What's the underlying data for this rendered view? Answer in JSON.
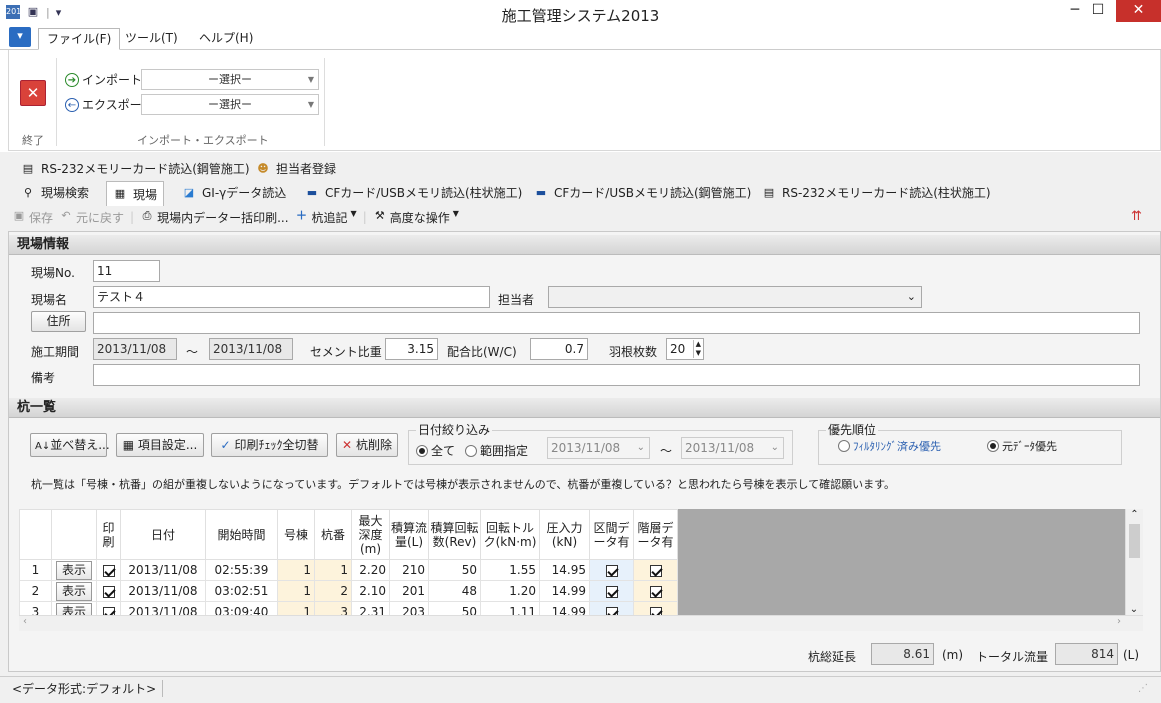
{
  "window": {
    "title": "施工管理システム2013",
    "min": "─",
    "max": "☐",
    "close": "✕",
    "qat": "▾"
  },
  "menu": {
    "file": "ファイル(F)",
    "tool": "ツール(T)",
    "help": "ヘルプ(H)",
    "file_btn": "▾"
  },
  "ribbon": {
    "import_label": "インポート",
    "export_label": "エクスポート",
    "import_value": "ー選択ー",
    "export_value": "ー選択ー",
    "exit_group": "終了",
    "io_group": "インポート・エクスポート"
  },
  "actions": {
    "rs232_steel": "RS-232メモリーカード読込(鋼管施工)",
    "staff": "担当者登録"
  },
  "tabs": [
    "現場検索",
    "現場",
    "GI-γデータ読込",
    "CFカード/USBメモリ読込(柱状施工)",
    "CFカード/USBメモリ読込(鋼管施工)",
    "RS-232メモリーカード読込(柱状施工)"
  ],
  "toolbar": {
    "save": "保存",
    "undo": "元に戻す",
    "print": "現場内データー括印刷...",
    "add_pile": "杭追記",
    "advanced": "高度な操作"
  },
  "site": {
    "header": "現場情報",
    "no_label": "現場No.",
    "no": "11",
    "name_label": "現場名",
    "name": "テスト４",
    "staff_label": "担当者",
    "address_btn": "住所",
    "period_label": "施工期間",
    "start": "2013/11/08",
    "tilde": "～",
    "end": "2013/11/08",
    "cement_label": "セメント比重",
    "cement": "3.15",
    "ratio_label": "配合比(W/C)",
    "ratio": "0.7",
    "blades_label": "羽根枚数",
    "blades": "20",
    "notes_label": "備考"
  },
  "pile": {
    "header": "杭一覧",
    "sort_btn": "並べ替え...",
    "item_btn": "項目設定...",
    "print_toggle_btn": "印刷ﾁｪｯｸ全切替",
    "delete_btn": "杭削除",
    "date_filter": "日付絞り込み",
    "all": "全て",
    "range": "範囲指定",
    "range_from": "2013/11/08",
    "range_to": "2013/11/08",
    "priority": "優先順位",
    "filtered": "ﾌｨﾙﾀﾘﾝｸﾞ済み優先",
    "original": "元ﾃﾞｰﾀ優先",
    "note": "杭一覧は「号棟・杭番」の組が重複しないようになっています。デフォルトでは号棟が表示されませんので、杭番が重複している？と思われたら号棟を表示して確認願います。"
  },
  "grid": {
    "headers": [
      "印刷",
      "日付",
      "開始時間",
      "号棟",
      "杭番",
      "最大深度(m)",
      "積算流量(L)",
      "積算回転数(Rev)",
      "回転トルク(kN·m)",
      "圧入力(kN)",
      "区間データ有",
      "階層データ有"
    ],
    "show": "表示",
    "rows": [
      {
        "n": "1",
        "date": "2013/11/08",
        "time": "02:55:39",
        "bldg": "1",
        "pile": "1",
        "depth": "2.20",
        "flow": "210",
        "rev": "50",
        "torque": "1.55",
        "force": "14.95"
      },
      {
        "n": "2",
        "date": "2013/11/08",
        "time": "03:02:51",
        "bldg": "1",
        "pile": "2",
        "depth": "2.10",
        "flow": "201",
        "rev": "48",
        "torque": "1.20",
        "force": "14.99"
      },
      {
        "n": "3",
        "date": "2013/11/08",
        "time": "03:09:40",
        "bldg": "1",
        "pile": "3",
        "depth": "2.31",
        "flow": "203",
        "rev": "50",
        "torque": "1.11",
        "force": "14.99"
      }
    ]
  },
  "summary": {
    "len_label": "杭総延長",
    "len": "8.61",
    "len_unit": "(m)",
    "flow_label": "トータル流量",
    "flow": "814",
    "flow_unit": "(L)"
  },
  "status": {
    "format": "<データ形式:デフォルト>"
  }
}
